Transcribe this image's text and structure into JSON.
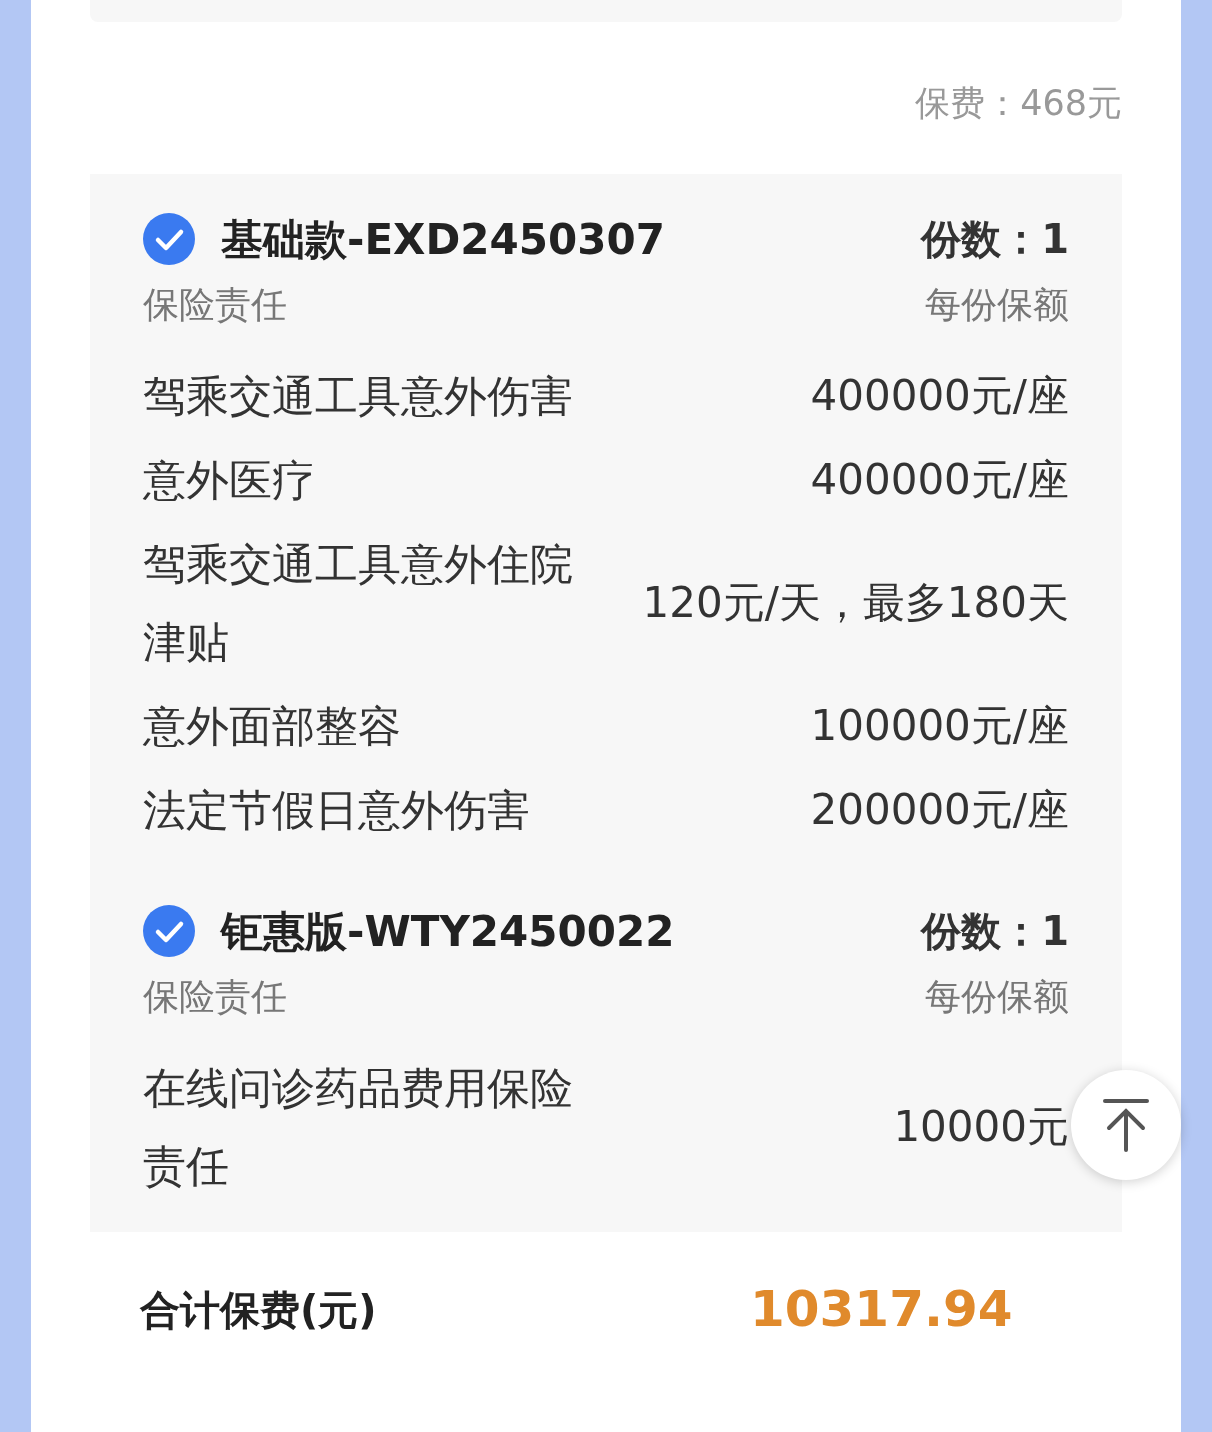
{
  "premium_line": "保费：468元",
  "plans": [
    {
      "checked": true,
      "title": "基础款-EXD2450307",
      "copies": "份数：1",
      "col_left": "保险责任",
      "col_right": "每份保额",
      "rows": [
        {
          "name": "驾乘交通工具意外伤害",
          "amount": "400000元/座"
        },
        {
          "name": "意外医疗",
          "amount": "400000元/座"
        },
        {
          "name": "驾乘交通工具意外住院津贴",
          "amount": "120元/天，最多180天"
        },
        {
          "name": "意外面部整容",
          "amount": "100000元/座"
        },
        {
          "name": "法定节假日意外伤害",
          "amount": "200000元/座"
        }
      ]
    },
    {
      "checked": true,
      "title": "钜惠版-WTY2450022",
      "copies": "份数：1",
      "col_left": "保险责任",
      "col_right": "每份保额",
      "rows": [
        {
          "name": "在线问诊药品费用保险责任",
          "amount": "10000元"
        }
      ]
    }
  ],
  "total": {
    "label": "合计保费(元)",
    "value": "10317.94"
  }
}
